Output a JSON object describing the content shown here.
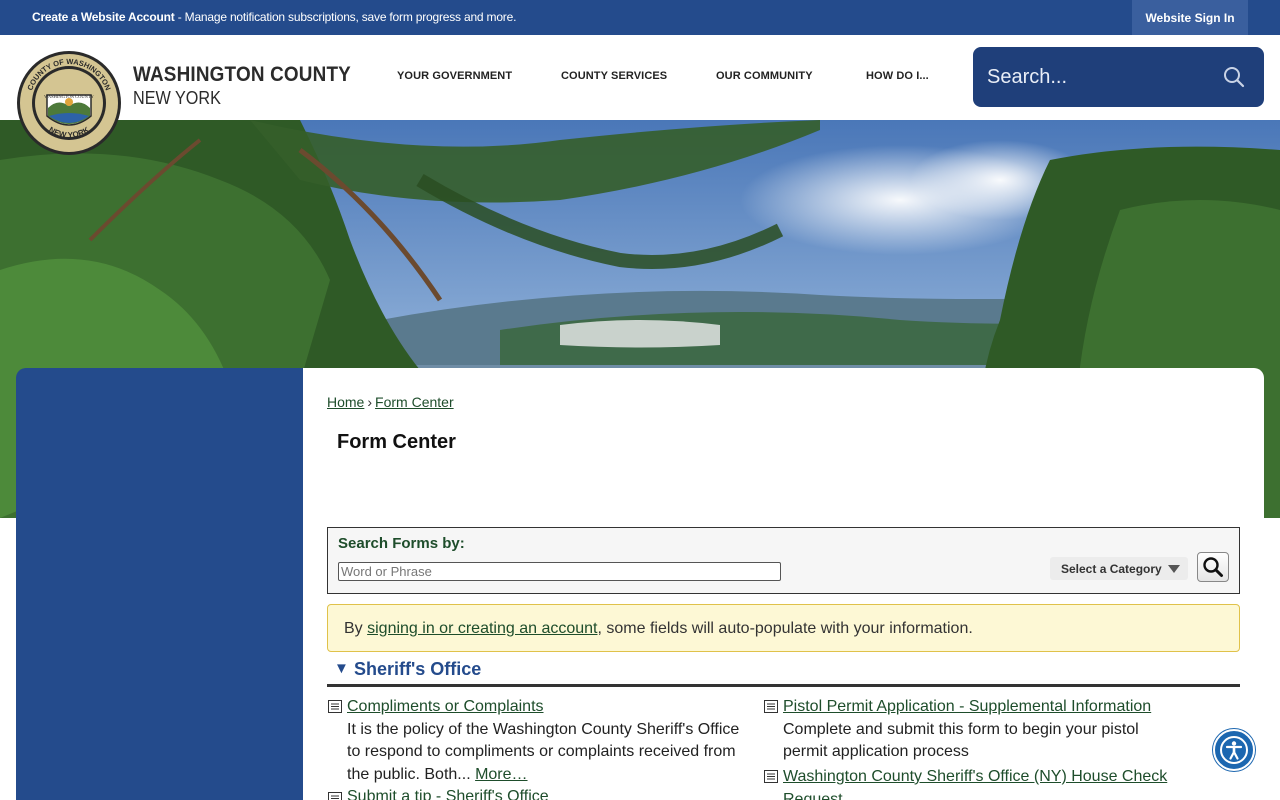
{
  "topbar": {
    "account_bold": "Create a Website Account",
    "account_rest": " - Manage notification subscriptions, save form progress and more.",
    "signin_label": "Website Sign In"
  },
  "brand": {
    "title": "WASHINGTON COUNTY",
    "subtitle": "NEW YORK",
    "seal_top": "COUNTY OF WASHINGTON",
    "seal_bottom": "NEW YORK",
    "seal_center": "WASHINGTON COUNTY"
  },
  "nav": {
    "items": [
      "YOUR GOVERNMENT",
      "COUNTY SERVICES",
      "OUR COMMUNITY",
      "HOW DO I..."
    ]
  },
  "search": {
    "placeholder": "Search..."
  },
  "breadcrumb": {
    "home": "Home",
    "separator": "›",
    "current": "Form Center"
  },
  "page": {
    "title": "Form Center"
  },
  "search_forms": {
    "label": "Search Forms by:",
    "placeholder": "Word or Phrase",
    "category_label": "Select a Category"
  },
  "notice": {
    "prefix": "By ",
    "link": "signing in or creating an account",
    "suffix": ", some fields will auto-populate with your information."
  },
  "section": {
    "arrow": "▼",
    "title": "Sheriff's Office",
    "forms": [
      {
        "title": "Compliments or Complaints",
        "desc_lines": [
          "It is the policy of the Washington County Sheriff's Office",
          "to respond to compliments or complaints received from",
          "the public. Both... "
        ],
        "more": "More…"
      },
      {
        "title": "Submit a tip - Sheriff's Office"
      },
      {
        "title": "Pistol Permit Application - Supplemental Information",
        "desc_lines": [
          "Complete and submit this form to begin your pistol",
          "permit application process"
        ]
      },
      {
        "title_lines": [
          "Washington County Sheriff's Office (NY) House Check",
          "Request"
        ]
      }
    ]
  },
  "colors": {
    "primary_blue": "#244b8c",
    "link_green": "#1e4d2b",
    "notice_bg": "#fdf8d5"
  }
}
